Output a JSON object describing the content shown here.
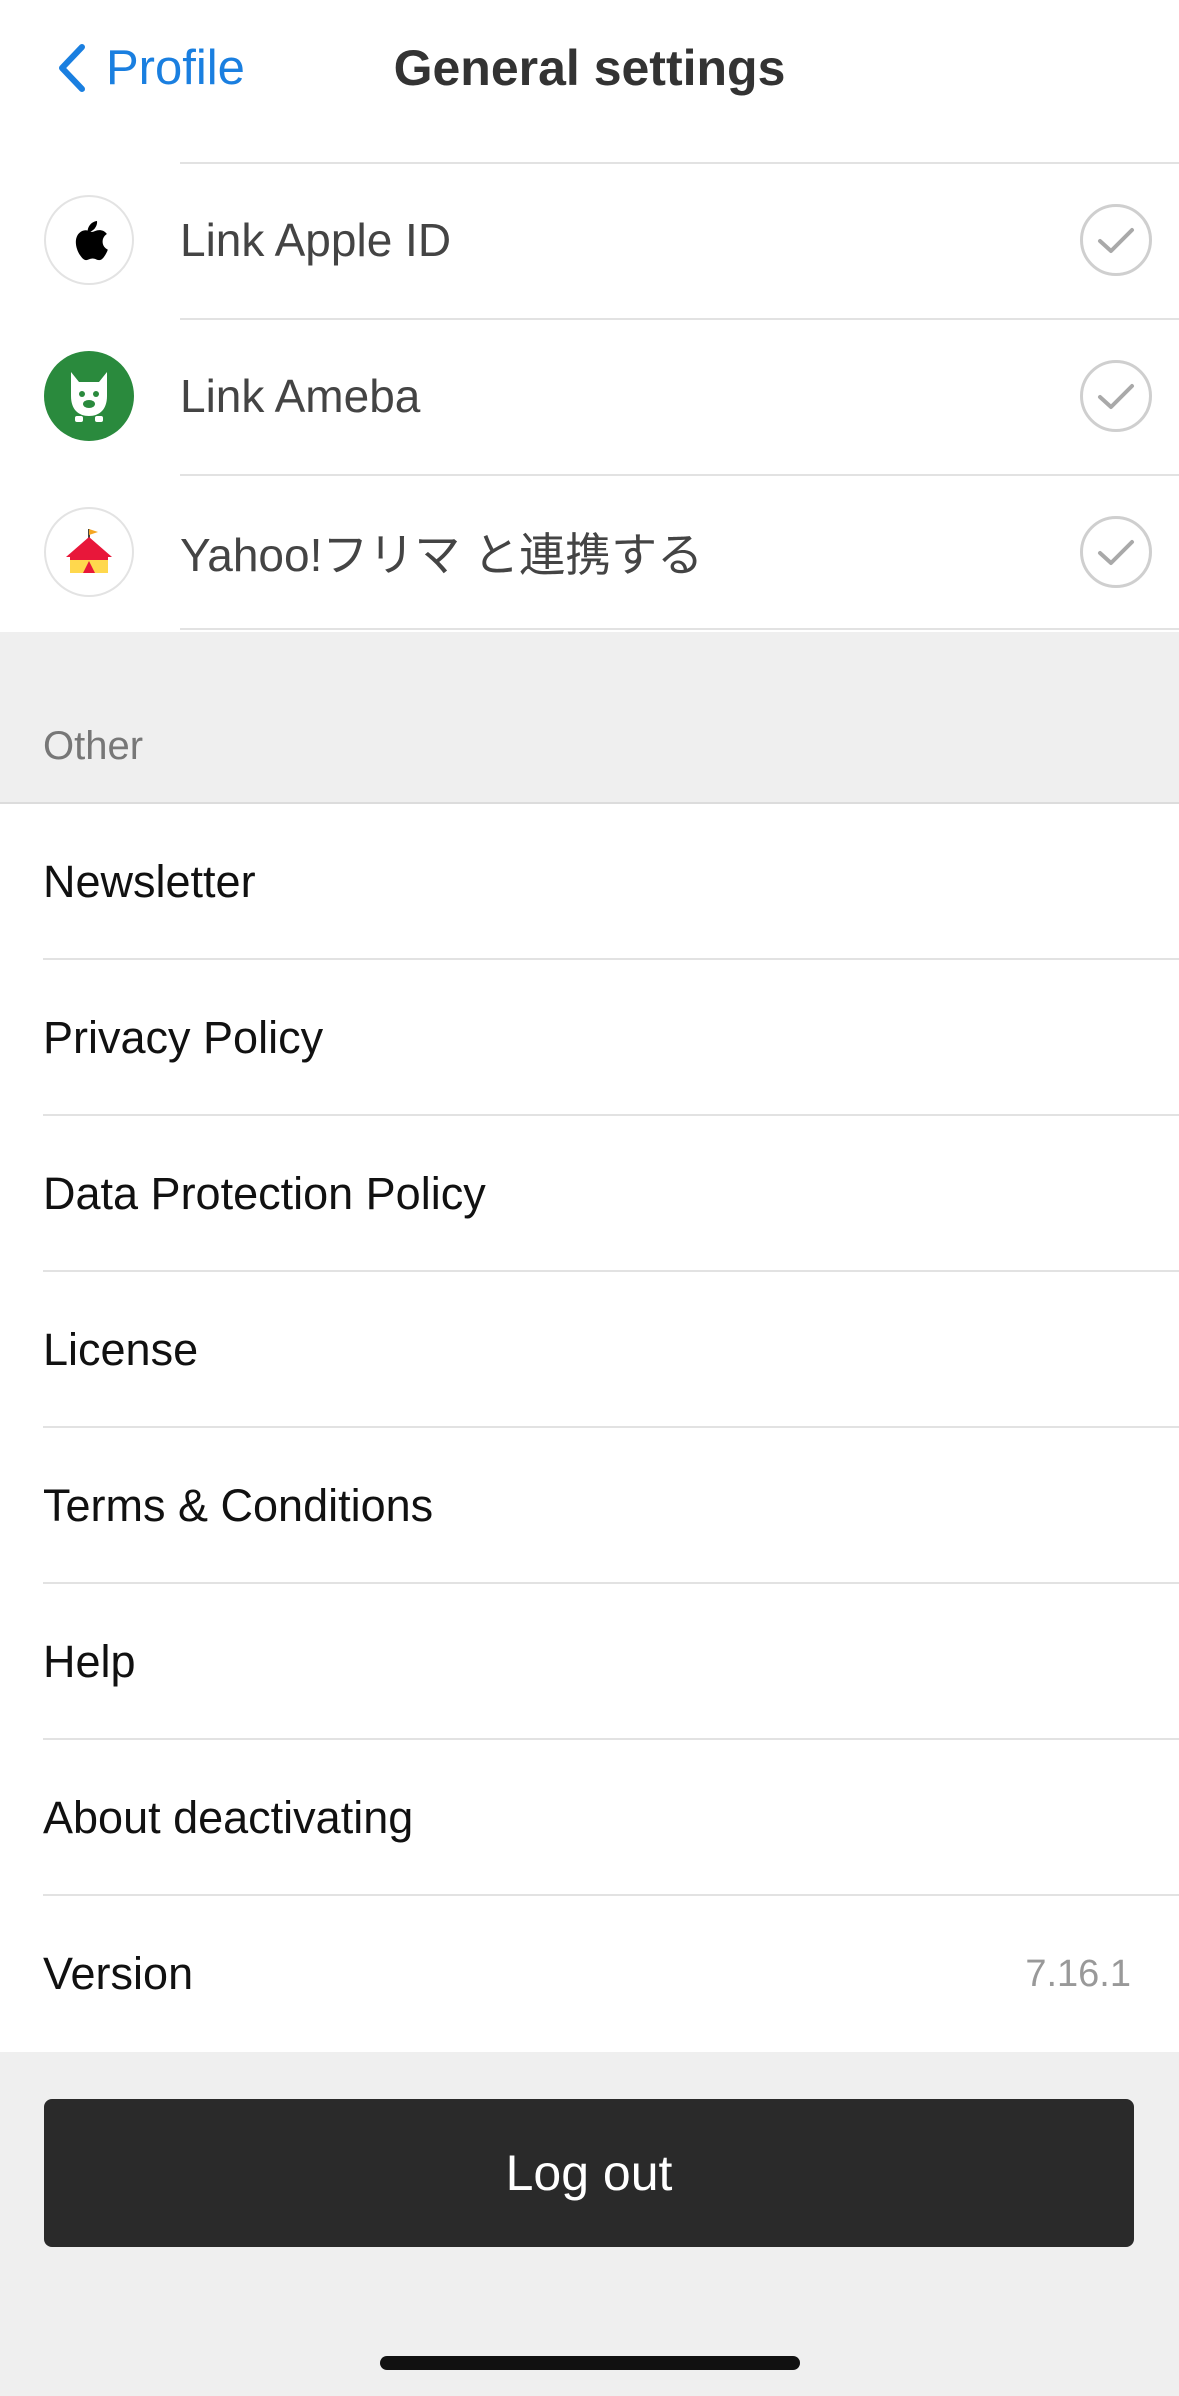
{
  "nav": {
    "back_label": "Profile",
    "title": "General settings"
  },
  "links": [
    {
      "label": "Link Apple ID",
      "icon": "apple-icon",
      "linked": true
    },
    {
      "label": "Link Ameba",
      "icon": "ameba-icon",
      "linked": true
    },
    {
      "label": "Yahoo!フリマ と連携する",
      "icon": "yahoo-flea-market-icon",
      "linked": true
    }
  ],
  "other": {
    "header": "Other",
    "items": [
      {
        "label": "Newsletter"
      },
      {
        "label": "Privacy Policy"
      },
      {
        "label": "Data Protection Policy"
      },
      {
        "label": "License"
      },
      {
        "label": "Terms & Conditions"
      },
      {
        "label": "Help"
      },
      {
        "label": "About deactivating"
      },
      {
        "label": "Version",
        "value": "7.16.1"
      }
    ]
  },
  "logout_label": "Log out",
  "colors": {
    "accent": "#1a7fe0",
    "ameba_green": "#2a8a3d",
    "logout_bg": "#2a2a2a"
  }
}
